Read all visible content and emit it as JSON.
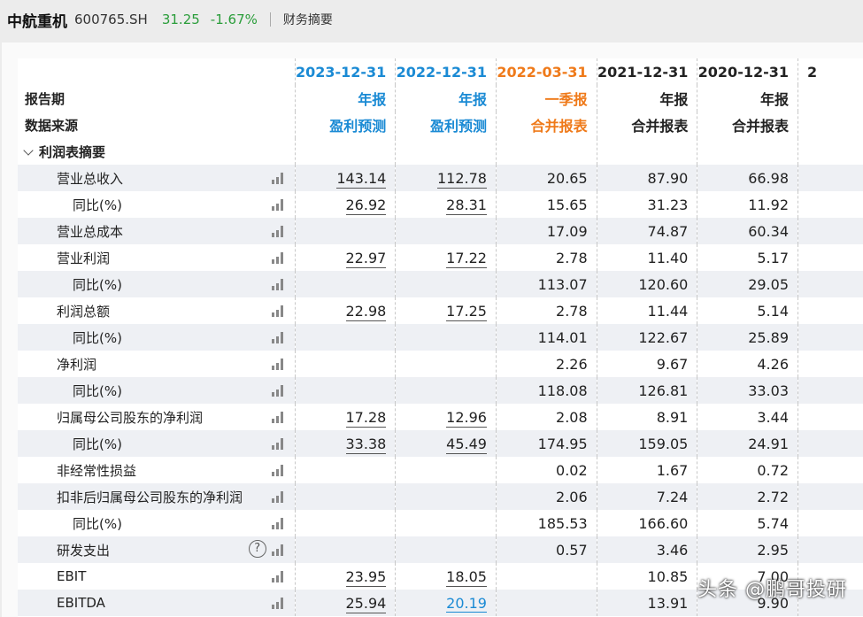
{
  "header": {
    "name": "中航重机",
    "code": "600765.SH",
    "price": "31.25",
    "change": "-1.67%",
    "tab": "财务摘要"
  },
  "columns": [
    {
      "date": "2023-12-31",
      "type": "年报",
      "source": "盈利预测",
      "color": "#1a8ad4"
    },
    {
      "date": "2022-12-31",
      "type": "年报",
      "source": "盈利预测",
      "color": "#1a8ad4"
    },
    {
      "date": "2022-03-31",
      "type": "一季报",
      "source": "合并报表",
      "color": "#ef7a1a"
    },
    {
      "date": "2021-12-31",
      "type": "年报",
      "source": "合并报表",
      "color": "#222222"
    },
    {
      "date": "2020-12-31",
      "type": "年报",
      "source": "合并报表",
      "color": "#222222"
    },
    {
      "date": "2",
      "type": "",
      "source": "",
      "color": "#222222"
    }
  ],
  "header_labels": {
    "period": "报告期",
    "source": "数据来源"
  },
  "section": "利润表摘要",
  "rows": [
    {
      "label": "营业总收入",
      "values": [
        "143.14",
        "112.78",
        "20.65",
        "87.90",
        "66.98",
        ""
      ]
    },
    {
      "label": "同比(%)",
      "values": [
        "26.92",
        "28.31",
        "15.65",
        "31.23",
        "11.92",
        ""
      ]
    },
    {
      "label": "营业总成本",
      "values": [
        "",
        "",
        "17.09",
        "74.87",
        "60.34",
        ""
      ]
    },
    {
      "label": "营业利润",
      "values": [
        "22.97",
        "17.22",
        "2.78",
        "11.40",
        "5.17",
        ""
      ]
    },
    {
      "label": "同比(%)",
      "values": [
        "",
        "",
        "113.07",
        "120.60",
        "29.05",
        ""
      ]
    },
    {
      "label": "利润总额",
      "values": [
        "22.98",
        "17.25",
        "2.78",
        "11.44",
        "5.14",
        ""
      ]
    },
    {
      "label": "同比(%)",
      "values": [
        "",
        "",
        "114.01",
        "122.67",
        "25.89",
        ""
      ]
    },
    {
      "label": "净利润",
      "values": [
        "",
        "",
        "2.26",
        "9.67",
        "4.26",
        ""
      ]
    },
    {
      "label": "同比(%)",
      "values": [
        "",
        "",
        "118.08",
        "126.81",
        "33.03",
        ""
      ]
    },
    {
      "label": "归属母公司股东的净利润",
      "values": [
        "17.28",
        "12.96",
        "2.08",
        "8.91",
        "3.44",
        ""
      ]
    },
    {
      "label": "同比(%)",
      "values": [
        "33.38",
        "45.49",
        "174.95",
        "159.05",
        "24.91",
        ""
      ]
    },
    {
      "label": "非经常性损益",
      "values": [
        "",
        "",
        "0.02",
        "1.67",
        "0.72",
        ""
      ]
    },
    {
      "label": "扣非后归属母公司股东的净利润",
      "values": [
        "",
        "",
        "2.06",
        "7.24",
        "2.72",
        ""
      ]
    },
    {
      "label": "同比(%)",
      "values": [
        "",
        "",
        "185.53",
        "166.60",
        "5.74",
        ""
      ]
    },
    {
      "label": "研发支出",
      "values": [
        "",
        "",
        "0.57",
        "3.46",
        "2.95",
        ""
      ]
    },
    {
      "label": "EBIT",
      "values": [
        "23.95",
        "18.05",
        "",
        "10.85",
        "7.00",
        ""
      ]
    },
    {
      "label": "EBITDA",
      "values": [
        "25.94",
        "20.19",
        "",
        "13.91",
        "9.90",
        ""
      ]
    }
  ],
  "help_symbol": "?",
  "watermark": "头条 @鹏哥投研"
}
